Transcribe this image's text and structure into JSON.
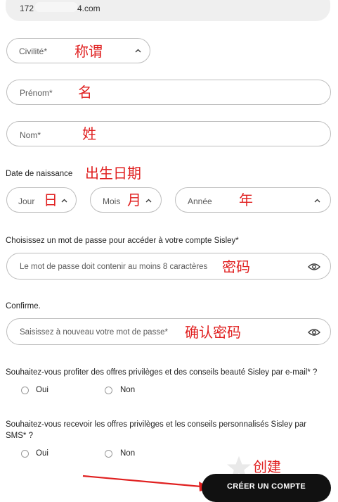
{
  "email": {
    "prefix": "172",
    "suffix": "4.com"
  },
  "civilite": {
    "placeholder": "Civilité*",
    "annotation": "称谓"
  },
  "prenom": {
    "placeholder": "Prénom*",
    "annotation": "名"
  },
  "nom": {
    "placeholder": "Nom*",
    "annotation": "姓"
  },
  "birth": {
    "label": "Date de naissance",
    "annotation": "出生日期",
    "day": {
      "placeholder": "Jour",
      "annotation": "日"
    },
    "month": {
      "placeholder": "Mois",
      "annotation": "月"
    },
    "year": {
      "placeholder": "Année",
      "annotation": "年"
    }
  },
  "password": {
    "label": "Choisissez un mot de passe pour accéder à votre compte Sisley*",
    "placeholder": "Le mot de passe doit contenir au moins 8 caractères",
    "annotation": "密码"
  },
  "confirm": {
    "label": "Confirme.",
    "placeholder": "Saisissez à nouveau votre mot de passe*",
    "annotation": "确认密码"
  },
  "email_offers": {
    "question": "Souhaitez-vous profiter des offres privilèges et des conseils beauté Sisley par e-mail* ?",
    "yes": "Oui",
    "no": "Non"
  },
  "sms_offers": {
    "question_line1": "Souhaitez-vous recevoir les offres privilèges et les conseils personnalisés Sisley par",
    "question_line2": "SMS* ?",
    "yes": "Oui",
    "no": "Non"
  },
  "submit": {
    "label": "CRÉER UN COMPTE",
    "annotation": "创建"
  },
  "colors": {
    "annotation": "#e02020",
    "button": "#111111",
    "border": "#bdbdbd"
  }
}
